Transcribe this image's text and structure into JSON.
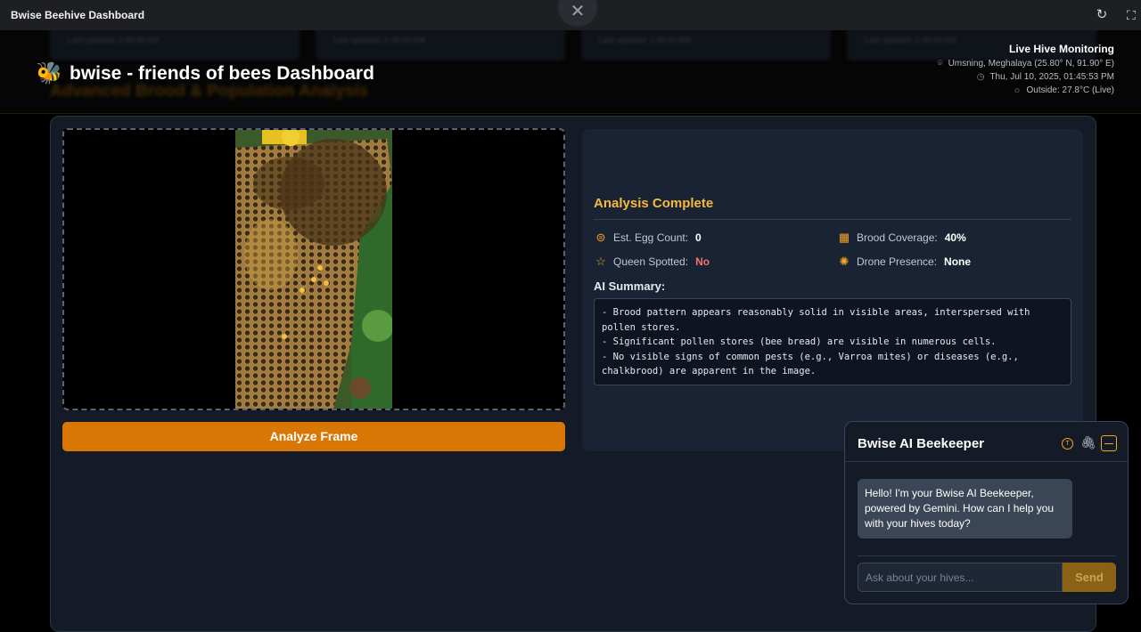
{
  "window": {
    "title": "Bwise Beehive Dashboard",
    "close_icon": "close-icon",
    "refresh_icon": "refresh-icon",
    "fullscreen_icon": "fullscreen-icon"
  },
  "header": {
    "brand_icon": "bee-icon",
    "brand_title": "bwise - friends of bees Dashboard",
    "ghost_cards": [
      "Last updated: 1:45:50 AM",
      "Last updated: 1:45:50 AM",
      "Last updated: 1:45:50 AM",
      "Last updated: 1:45:50 AM"
    ],
    "ghost_title": "Advanced Brood & Population Analysis",
    "live": {
      "heading": "Live Hive Monitoring",
      "location": "Umsning, Meghalaya (25.80° N, 91.90° E)",
      "datetime": "Thu, Jul 10, 2025, 01:45:53 PM",
      "outside": "Outside: 27.8°C (Live)"
    }
  },
  "analysis": {
    "button_label": "Analyze Frame",
    "status_title": "Analysis Complete",
    "metrics": {
      "egg_label": "Est. Egg Count:",
      "egg_value": "0",
      "brood_label": "Brood Coverage:",
      "brood_value": "40%",
      "queen_label": "Queen Spotted:",
      "queen_value": "No",
      "drone_label": "Drone Presence:",
      "drone_value": "None"
    },
    "summary_label": "AI Summary:",
    "summary_text": "- Brood pattern appears reasonably solid in visible areas, interspersed with\npollen stores.\n- Significant pollen stores (bee bread) are visible in numerous cells.\n- No visible signs of common pests (e.g., Varroa mites) or diseases (e.g.,\nchalkbrood) are apparent in the image."
  },
  "chat": {
    "title": "Bwise AI Beekeeper",
    "greeting": "Hello! I'm your Bwise AI Beekeeper, powered by Gemini. How can I help you with your hives today?",
    "input_placeholder": "Ask about your hives...",
    "send_label": "Send"
  },
  "colors": {
    "accent": "#d97706",
    "title_accent": "#f5b93d",
    "panel": "#141b27",
    "negative": "#f87171"
  }
}
